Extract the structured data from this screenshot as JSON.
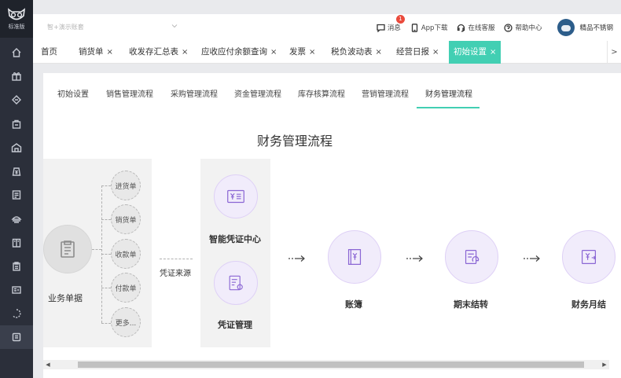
{
  "logo": {
    "text": "标准版"
  },
  "topbar": {
    "account_placeholder": "智+演示账套",
    "actions": {
      "message": "消息",
      "message_badge": "1",
      "app_download": "App下载",
      "online_service": "在线客服",
      "help_center": "帮助中心"
    },
    "username": "精品不锈钢"
  },
  "tabs": [
    {
      "label": "首页"
    },
    {
      "label": "销货单"
    },
    {
      "label": "收发存汇总表"
    },
    {
      "label": "应收应付余额查询"
    },
    {
      "label": "发票"
    },
    {
      "label": "税负波动表"
    },
    {
      "label": "经营日报"
    },
    {
      "label": "初始设置"
    }
  ],
  "tab_close": "×",
  "tab_scroll": ">",
  "subtabs": [
    {
      "label": "初始设置"
    },
    {
      "label": "销售管理流程"
    },
    {
      "label": "采购管理流程"
    },
    {
      "label": "资金管理流程"
    },
    {
      "label": "库存核算流程"
    },
    {
      "label": "营销管理流程"
    },
    {
      "label": "财务管理流程"
    }
  ],
  "flow": {
    "title": "财务管理流程",
    "business_docs": "业务单据",
    "doc_types": [
      "进货单",
      "销货单",
      "收款单",
      "付款单",
      "更多..."
    ],
    "voucher_source": "凭证来源",
    "smart_voucher": "智能凭证中心",
    "voucher_mgmt": "凭证管理",
    "ledger": "账簿",
    "period_end": "期末结转",
    "monthly": "财务月结",
    "arrow_glyph": "···→"
  },
  "colors": {
    "accent": "#42cfb3",
    "sidebar": "#2b2f3a",
    "purple": "#8a66d4"
  },
  "scrollbar": {
    "left": "◀",
    "right": "▶"
  }
}
